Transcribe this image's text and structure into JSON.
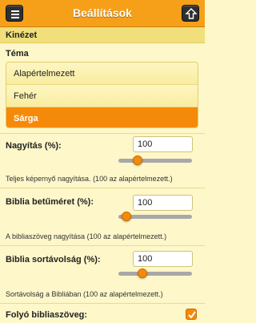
{
  "header": {
    "title": "Beállítások"
  },
  "section": {
    "title": "Kinézet"
  },
  "theme": {
    "label": "Téma",
    "options": [
      "Alapértelmezett",
      "Fehér",
      "Sárga"
    ],
    "selected": "Sárga"
  },
  "zoom": {
    "label": "Nagyítás (%):",
    "value": "100",
    "slider_fraction": 0.22,
    "description": "Teljes képernyő nagyítása. (100 az alapértelmezett.)"
  },
  "font_size": {
    "label": "Biblia betűméret (%):",
    "value": "100",
    "slider_fraction": 0.05,
    "description": "A bibliaszöveg nagyítása (100 az alapértelmezett.)"
  },
  "line_spacing": {
    "label": "Biblia sortávolság (%):",
    "value": "100",
    "slider_fraction": 0.3,
    "description": "Sortávolság a Bibliában (100 az alapértelmezett.)"
  },
  "flowing_text": {
    "label": "Folyó bibliaszöveg:",
    "checked": true
  },
  "colors": {
    "accent": "#f58a0a",
    "header": "#f6a01a",
    "background": "#fdf7c9"
  }
}
